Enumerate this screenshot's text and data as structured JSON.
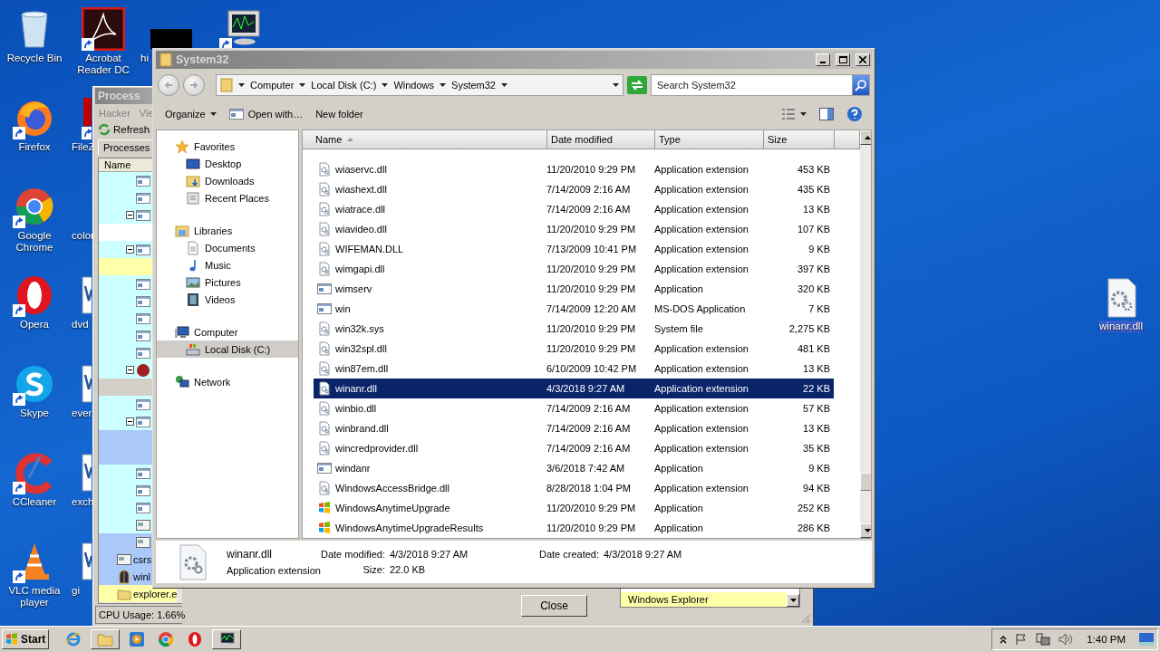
{
  "desktop_icons": [
    [
      {
        "kind": "recycle-bin",
        "label": "Recycle Bin",
        "shortcut": false
      },
      {
        "kind": "firefox",
        "label": "Firefox",
        "shortcut": true
      },
      {
        "kind": "chrome",
        "label": "Google Chrome",
        "shortcut": true
      },
      {
        "kind": "opera",
        "label": "Opera",
        "shortcut": true
      },
      {
        "kind": "skype",
        "label": "Skype",
        "shortcut": true
      },
      {
        "kind": "ccleaner",
        "label": "CCleaner",
        "shortcut": true
      },
      {
        "kind": "vlc",
        "label": "VLC media player",
        "shortcut": true
      }
    ],
    [
      {
        "kind": "acrobat",
        "label": "Acrobat Reader DC",
        "shortcut": true
      },
      {
        "kind": "filezilla",
        "label": "FileZ",
        "shortcut": true
      },
      {
        "kind": "none",
        "label": "color",
        "shortcut": false
      },
      {
        "kind": "document",
        "label": "dvd",
        "shortcut": false
      },
      {
        "kind": "document",
        "label": "ever",
        "shortcut": false
      },
      {
        "kind": "document",
        "label": "exch",
        "shortcut": false
      },
      {
        "kind": "document",
        "label": "gi",
        "shortcut": false
      }
    ],
    [
      {
        "kind": "black",
        "label": "hi",
        "shortcut": false
      }
    ],
    [
      {
        "kind": "monitor",
        "shortcut": true
      }
    ]
  ],
  "desktop_file": {
    "kind": "dll",
    "label": "winanr.dll",
    "selected": true
  },
  "process_window": {
    "title": "Process",
    "menu": [
      "Hacker",
      "Vie"
    ],
    "toolbar": [
      "Refresh"
    ],
    "tabs": [
      {
        "label": "Processes",
        "selected": true
      }
    ],
    "column": "Name",
    "rows": [
      {
        "color": "#ccffff",
        "kind": "app"
      },
      {
        "color": "#ccffff",
        "kind": "app"
      },
      {
        "color": "#ccffff",
        "kind": "app",
        "expanded": true
      },
      {
        "color": "#ffffff",
        "kind": "none"
      },
      {
        "color": "#ccffff",
        "kind": "app",
        "expanded": true
      },
      {
        "color": "#ffffaa",
        "kind": "none"
      },
      {
        "color": "#ccffff",
        "kind": "app"
      },
      {
        "color": "#ccffff",
        "kind": "app"
      },
      {
        "color": "#ccffff",
        "kind": "app"
      },
      {
        "color": "#ccffff",
        "kind": "app"
      },
      {
        "color": "#ccffff",
        "kind": "app"
      },
      {
        "color": "#ccffff",
        "kind": "colored",
        "expanded": true
      },
      {
        "color": "#d4d0c8",
        "kind": "none"
      },
      {
        "color": "#ccffff",
        "kind": "app"
      },
      {
        "color": "#ccffff",
        "kind": "app",
        "expanded": true
      },
      {
        "color": "#aac8f8",
        "kind": "none"
      },
      {
        "color": "#aac8f8",
        "kind": "none"
      },
      {
        "color": "#ccffff",
        "kind": "app"
      },
      {
        "color": "#ccffff",
        "kind": "app"
      },
      {
        "color": "#ccffff",
        "kind": "app"
      },
      {
        "color": "#ccffff",
        "kind": "window"
      },
      {
        "color": "#aac8f8",
        "kind": "window"
      },
      {
        "color": "#aac8f8",
        "kind": "window",
        "label": "csrs"
      },
      {
        "color": "#aac8f8",
        "kind": "gate",
        "label": "winl"
      },
      {
        "color": "#ffffaa",
        "kind": "folder",
        "label": "explorer.e"
      }
    ],
    "status": "CPU Usage: 1.66%"
  },
  "dialog": {
    "list_item": "Windows Explorer",
    "button": "Close"
  },
  "explorer": {
    "title": "System32",
    "breadcrumb": [
      "Computer",
      "Local Disk (C:)",
      "Windows",
      "System32"
    ],
    "search": {
      "placeholder": "Search System32"
    },
    "toolbar": [
      {
        "label": "Organize",
        "kind": "menu"
      },
      {
        "label": "Open with…",
        "kind": "open"
      },
      {
        "label": "New folder",
        "kind": "plain"
      }
    ],
    "nav": [
      {
        "label": "Favorites",
        "kind": "star",
        "selected": false,
        "children": [
          {
            "label": "Desktop",
            "kind": "desktop",
            "selected": false
          },
          {
            "label": "Downloads",
            "kind": "downloads",
            "selected": false
          },
          {
            "label": "Recent Places",
            "kind": "recent",
            "selected": false
          }
        ]
      },
      {
        "label": "Libraries",
        "kind": "libraries",
        "selected": false,
        "children": [
          {
            "label": "Documents",
            "kind": "documents",
            "selected": false
          },
          {
            "label": "Music",
            "kind": "music",
            "selected": false
          },
          {
            "label": "Pictures",
            "kind": "pictures",
            "selected": false
          },
          {
            "label": "Videos",
            "kind": "videos",
            "selected": false
          }
        ]
      },
      {
        "label": "Computer",
        "kind": "computer",
        "selected": false,
        "children": [
          {
            "label": "Local Disk (C:)",
            "kind": "disk",
            "selected": true
          }
        ]
      },
      {
        "label": "Network",
        "kind": "network",
        "selected": false
      }
    ],
    "columns": [
      {
        "label": "Name",
        "sorted": true
      },
      {
        "label": "Date modified",
        "sorted": false
      },
      {
        "label": "Type",
        "sorted": false
      },
      {
        "label": "Size",
        "sorted": false
      }
    ],
    "files": [
      {
        "name": "wiaservc.dll",
        "date": "11/20/2010 9:29 PM",
        "type": "Application extension",
        "size": "453 KB",
        "kind": "dll",
        "selected": false
      },
      {
        "name": "wiashext.dll",
        "date": "7/14/2009 2:16 AM",
        "type": "Application extension",
        "size": "435 KB",
        "kind": "dll",
        "selected": false
      },
      {
        "name": "wiatrace.dll",
        "date": "7/14/2009 2:16 AM",
        "type": "Application extension",
        "size": "13 KB",
        "kind": "dll",
        "selected": false
      },
      {
        "name": "wiavideo.dll",
        "date": "11/20/2010 9:29 PM",
        "type": "Application extension",
        "size": "107 KB",
        "kind": "dll",
        "selected": false
      },
      {
        "name": "WIFEMAN.DLL",
        "date": "7/13/2009 10:41 PM",
        "type": "Application extension",
        "size": "9 KB",
        "kind": "dll",
        "selected": false
      },
      {
        "name": "wimgapi.dll",
        "date": "11/20/2010 9:29 PM",
        "type": "Application extension",
        "size": "397 KB",
        "kind": "dll",
        "selected": false
      },
      {
        "name": "wimserv",
        "date": "11/20/2010 9:29 PM",
        "type": "Application",
        "size": "320 KB",
        "kind": "app",
        "selected": false
      },
      {
        "name": "win",
        "date": "7/14/2009 12:20 AM",
        "type": "MS-DOS Application",
        "size": "7 KB",
        "kind": "app",
        "selected": false
      },
      {
        "name": "win32k.sys",
        "date": "11/20/2010 9:29 PM",
        "type": "System file",
        "size": "2,275 KB",
        "kind": "dll",
        "selected": false
      },
      {
        "name": "win32spl.dll",
        "date": "11/20/2010 9:29 PM",
        "type": "Application extension",
        "size": "481 KB",
        "kind": "dll",
        "selected": false
      },
      {
        "name": "win87em.dll",
        "date": "6/10/2009 10:42 PM",
        "type": "Application extension",
        "size": "13 KB",
        "kind": "dll",
        "selected": false
      },
      {
        "name": "winanr.dll",
        "date": "4/3/2018 9:27 AM",
        "type": "Application extension",
        "size": "22 KB",
        "kind": "dll",
        "selected": true
      },
      {
        "name": "winbio.dll",
        "date": "7/14/2009 2:16 AM",
        "type": "Application extension",
        "size": "57 KB",
        "kind": "dll",
        "selected": false
      },
      {
        "name": "winbrand.dll",
        "date": "7/14/2009 2:16 AM",
        "type": "Application extension",
        "size": "13 KB",
        "kind": "dll",
        "selected": false
      },
      {
        "name": "wincredprovider.dll",
        "date": "7/14/2009 2:16 AM",
        "type": "Application extension",
        "size": "35 KB",
        "kind": "dll",
        "selected": false
      },
      {
        "name": "windanr",
        "date": "3/6/2018 7:42 AM",
        "type": "Application",
        "size": "9 KB",
        "kind": "app",
        "selected": false
      },
      {
        "name": "WindowsAccessBridge.dll",
        "date": "8/28/2018 1:04 PM",
        "type": "Application extension",
        "size": "94 KB",
        "kind": "dll",
        "selected": false
      },
      {
        "name": "WindowsAnytimeUpgrade",
        "date": "11/20/2010 9:29 PM",
        "type": "Application",
        "size": "252 KB",
        "kind": "upgrade",
        "selected": false
      },
      {
        "name": "WindowsAnytimeUpgradeResults",
        "date": "11/20/2010 9:29 PM",
        "type": "Application",
        "size": "286 KB",
        "kind": "upgrade",
        "selected": false
      }
    ],
    "details": {
      "name": "winanr.dll",
      "type": "Application extension",
      "fields": [
        {
          "label": "Date modified:",
          "value": "4/3/2018 9:27 AM"
        },
        {
          "label": "Date created:",
          "value": "4/3/2018 9:27 AM"
        },
        {
          "label": "Size:",
          "value": "22.0 KB"
        }
      ]
    }
  },
  "taskbar": {
    "start": "Start",
    "buttons": [
      {
        "kind": "ie",
        "open": false
      },
      {
        "kind": "explorer",
        "open": true
      },
      {
        "kind": "media",
        "open": false
      },
      {
        "kind": "chrome",
        "open": false
      },
      {
        "kind": "opera",
        "open": false
      },
      {
        "kind": "monitor",
        "open": true
      }
    ],
    "time": "1:40 PM"
  }
}
